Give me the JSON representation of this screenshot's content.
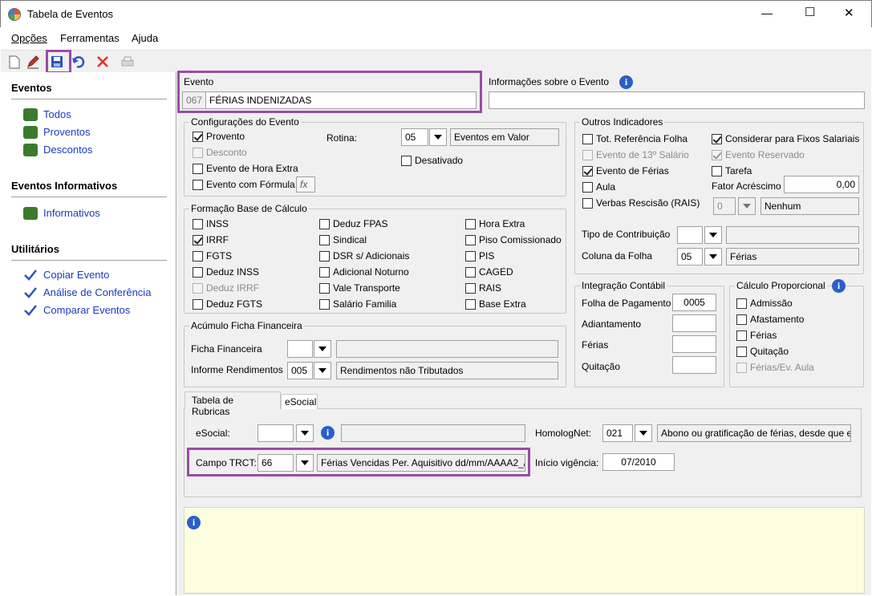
{
  "window": {
    "title": "Tabela de Eventos",
    "minimize": "—",
    "maximize": "☐",
    "close": "✕"
  },
  "menu": {
    "opcoes": "Opções",
    "ferramentas": "Ferramentas",
    "ajuda": "Ajuda"
  },
  "sidebar": {
    "eventos_title": "Eventos",
    "todos": "Todos",
    "proventos": "Proventos",
    "descontos": "Descontos",
    "informativos_title": "Eventos Informativos",
    "informativos": "Informativos",
    "utilitarios_title": "Utilitários",
    "copiar": "Copiar Evento",
    "analise": "Análise de Conferência",
    "comparar": "Comparar Eventos"
  },
  "evento": {
    "label": "Evento",
    "code": "067",
    "name": "FÉRIAS INDENIZADAS",
    "info_label": "Informações sobre o Evento",
    "info_value": ""
  },
  "config": {
    "title": "Configurações do Evento",
    "proventos": "Provento",
    "desconto": "Desconto",
    "hora_extra": "Evento de Hora Extra",
    "formula": "Evento com Fórmula",
    "formula_btn": "fx",
    "rotina_label": "Rotina:",
    "rotina_code": "05",
    "rotina_desc": "Eventos em Valor",
    "desativado": "Desativado"
  },
  "formacao": {
    "title": "Formação Base de Cálculo",
    "col1": [
      "INSS",
      "IRRF",
      "FGTS",
      "Deduz INSS",
      "Deduz IRRF",
      "Deduz FGTS"
    ],
    "col2": [
      "Deduz FPAS",
      "Sindical",
      "DSR s/ Adicionais",
      "Adicional Noturno",
      "Vale Transporte",
      "Salário Familia"
    ],
    "col3": [
      "Hora Extra",
      "Piso Comissionado",
      "PIS",
      "CAGED",
      "RAIS",
      "Base Extra"
    ]
  },
  "acumulo": {
    "title": "Acúmulo Ficha Financeira",
    "ficha_label": "Ficha Financeira",
    "ficha_code": "",
    "ficha_desc": "",
    "informe_label": "Informe Rendimentos",
    "informe_code": "005",
    "informe_desc": "Rendimentos não Tributados"
  },
  "outros": {
    "title": "Outros Indicadores",
    "tot_ref": "Tot. Referência Folha",
    "decimo": "Evento de 13º Salário",
    "ferias": "Evento de Férias",
    "aula": "Aula",
    "verbas": "Verbas Rescisão (RAIS)",
    "fixos": "Considerar para Fixos Salariais",
    "reservado": "Evento Reservado",
    "tarefa": "Tarefa",
    "fator_label": "Fator Acréscimo",
    "fator_value": "0,00",
    "verbas_code": "0",
    "verbas_desc": "Nenhum",
    "tipo_label": "Tipo de Contribuição",
    "tipo_code": "",
    "tipo_desc": "",
    "coluna_label": "Coluna da Folha",
    "coluna_code": "05",
    "coluna_desc": "Férias"
  },
  "integracao": {
    "title": "Integração Contábil",
    "folha_label": "Folha de Pagamento",
    "folha_value": "0005",
    "adiant_label": "Adiantamento",
    "adiant_value": "",
    "ferias_label": "Férias",
    "ferias_value": "",
    "quit_label": "Quitação",
    "quit_value": ""
  },
  "proporcional": {
    "title": "Cálculo Proporcional",
    "admissao": "Admissão",
    "afastamento": "Afastamento",
    "ferias": "Férias",
    "quitacao": "Quitação",
    "ferias_aula": "Férias/Ev. Aula"
  },
  "tabs": {
    "rubricas": "Tabela de Rubricas",
    "esocial": "eSocial"
  },
  "rubricas": {
    "esocial_label": "eSocial:",
    "esocial_code": "",
    "esocial_desc": "",
    "homolog_label": "HomologNet:",
    "homolog_code": "021",
    "homolog_desc": "Abono ou gratificação de férias, desde que e",
    "trct_label": "Campo TRCT:",
    "trct_code": "66",
    "trct_desc": "Férias Vencidas Per. Aquisitivo dd/mm/AAAA2_/",
    "inicio_label": "Início vigência:",
    "inicio_value": "07/2010"
  },
  "colors": {
    "accent": "#9b4aa8",
    "link": "#1a3bbf",
    "note_bg": "#fdfde0"
  }
}
